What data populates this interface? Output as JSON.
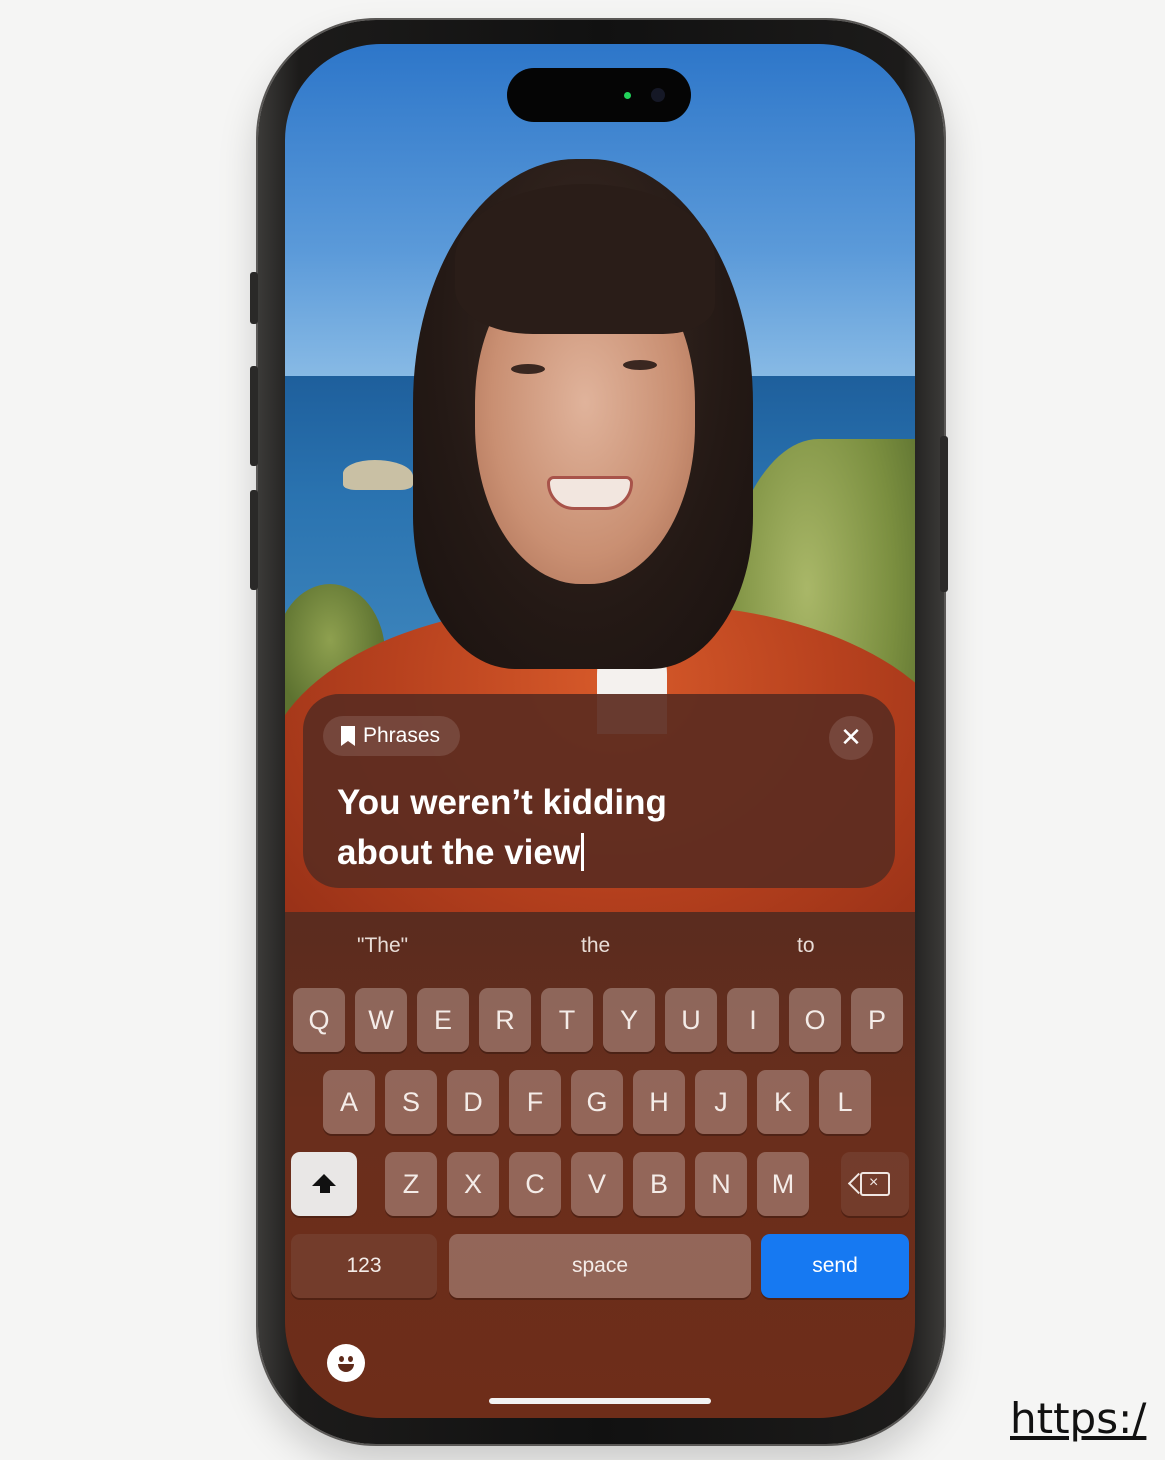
{
  "phrase_card": {
    "chip_label": "Phrases",
    "chip_icon": "bookmark-icon",
    "close_icon": "close-icon",
    "close_glyph": "✕",
    "text_line1": "You weren’t kidding",
    "text_line2": "about the view"
  },
  "keyboard": {
    "suggestions": [
      "\"The\"",
      "the",
      "to"
    ],
    "row1": [
      "Q",
      "W",
      "E",
      "R",
      "T",
      "Y",
      "U",
      "I",
      "O",
      "P"
    ],
    "row2": [
      "A",
      "S",
      "D",
      "F",
      "G",
      "H",
      "J",
      "K",
      "L"
    ],
    "row3": [
      "Z",
      "X",
      "C",
      "V",
      "B",
      "N",
      "M"
    ],
    "numbers_label": "123",
    "space_label": "space",
    "send_label": "send",
    "send_color": "#1679f2"
  },
  "footer": {
    "link_text": "https:/"
  }
}
